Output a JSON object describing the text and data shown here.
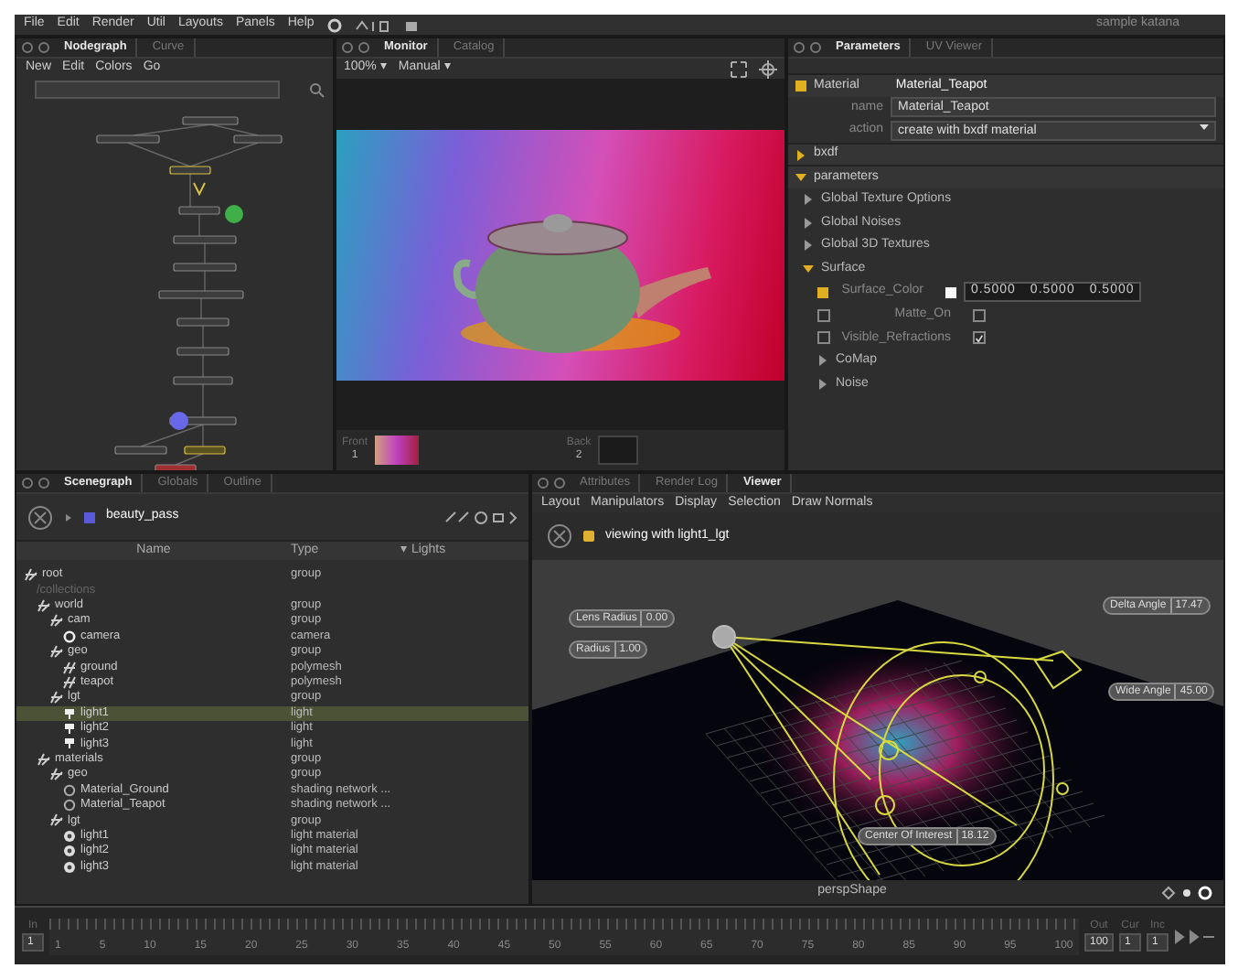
{
  "menu": [
    "File",
    "Edit",
    "Render",
    "Util",
    "Layouts",
    "Panels",
    "Help"
  ],
  "project_title": "sample katana",
  "nodegraph": {
    "tabs": [
      {
        "label": "Nodegraph",
        "selected": true
      },
      {
        "label": "Curve",
        "selected": false
      }
    ],
    "menu": [
      "New",
      "Edit",
      "Colors",
      "Go"
    ]
  },
  "monitor": {
    "tabs": [
      {
        "label": "Monitor",
        "selected": true
      },
      {
        "label": "Catalog",
        "selected": false
      }
    ],
    "toolbar": [
      "100% ▾",
      "Manual ▾"
    ],
    "front_label": "Front",
    "front_index": "1",
    "back_label": "Back",
    "back_index": "2"
  },
  "parameters": {
    "tabs": [
      {
        "label": "Parameters",
        "selected": true
      },
      {
        "label": "UV Viewer",
        "selected": false
      }
    ],
    "rows": [
      {
        "kind": "node",
        "label": "Material",
        "value": "Material_Teapot"
      },
      {
        "kind": "text",
        "label": "name",
        "value": "Material_Teapot"
      },
      {
        "kind": "dropdown",
        "label": "action",
        "value": "create with bxdf material"
      },
      {
        "kind": "section",
        "label": "bxdf",
        "expanded": false
      },
      {
        "kind": "section",
        "label": "parameters",
        "expanded": true
      },
      {
        "kind": "group",
        "label": "Global Texture Options",
        "expanded": false
      },
      {
        "kind": "group",
        "label": "Global Noises",
        "expanded": false
      },
      {
        "kind": "group",
        "label": "Global 3D Textures",
        "expanded": false
      },
      {
        "kind": "group",
        "label": "Surface",
        "expanded": true
      },
      {
        "kind": "color",
        "label": "Surface_Color",
        "values": [
          "0.5000",
          "0.5000",
          "0.5000"
        ]
      },
      {
        "kind": "check",
        "label": "Matte_On",
        "checked": false
      },
      {
        "kind": "check",
        "label": "Visible_Refractions",
        "checked": true
      },
      {
        "kind": "subgroup",
        "label": "CoMap",
        "expanded": false
      },
      {
        "kind": "subgroup",
        "label": "Noise",
        "expanded": false
      }
    ]
  },
  "scenegraph": {
    "tabs": [
      {
        "label": "Scenegraph",
        "selected": true
      },
      {
        "label": "Globals",
        "selected": false
      },
      {
        "label": "Outline",
        "selected": false
      }
    ],
    "pass": "beauty_pass",
    "columns": [
      "Name",
      "Type",
      "▾ Lights"
    ],
    "tree": [
      {
        "kind": "group",
        "name": "root",
        "type": "group",
        "selected": false,
        "children": [
          {
            "kind": "collection",
            "name": "/collections",
            "selected": false
          },
          {
            "kind": "group",
            "name": "world",
            "type": "group",
            "selected": false,
            "children": [
              {
                "kind": "group",
                "name": "cam",
                "type": "group",
                "selected": false,
                "children": [
                  {
                    "kind": "camera",
                    "name": "camera",
                    "type": "camera",
                    "selected": false
                  }
                ]
              },
              {
                "kind": "group",
                "name": "geo",
                "type": "group",
                "selected": false,
                "children": [
                  {
                    "kind": "mesh",
                    "name": "ground",
                    "type": "polymesh",
                    "selected": false
                  },
                  {
                    "kind": "mesh",
                    "name": "teapot",
                    "type": "polymesh",
                    "selected": false
                  }
                ]
              },
              {
                "kind": "group",
                "name": "lgt",
                "type": "group",
                "selected": false,
                "children": [
                  {
                    "kind": "light",
                    "name": "light1",
                    "type": "light",
                    "selected": true
                  },
                  {
                    "kind": "light",
                    "name": "light2",
                    "type": "light",
                    "selected": false
                  },
                  {
                    "kind": "light",
                    "name": "light3",
                    "type": "light",
                    "selected": false
                  }
                ]
              }
            ]
          },
          {
            "kind": "group",
            "name": "materials",
            "type": "group",
            "selected": false,
            "children": [
              {
                "kind": "group",
                "name": "geo",
                "type": "group",
                "selected": false,
                "children": [
                  {
                    "kind": "material",
                    "name": "Material_Ground",
                    "type": "shading network ...",
                    "selected": false
                  },
                  {
                    "kind": "material",
                    "name": "Material_Teapot",
                    "type": "shading network ...",
                    "selected": false
                  }
                ]
              },
              {
                "kind": "group",
                "name": "lgt",
                "type": "group",
                "selected": false,
                "children": [
                  {
                    "kind": "lightmat",
                    "name": "light1",
                    "type": "light material",
                    "selected": false
                  },
                  {
                    "kind": "lightmat",
                    "name": "light2",
                    "type": "light material",
                    "selected": false
                  },
                  {
                    "kind": "lightmat",
                    "name": "light3",
                    "type": "light material",
                    "selected": false
                  }
                ]
              }
            ]
          }
        ]
      }
    ]
  },
  "viewer": {
    "tabs": [
      {
        "label": "Attributes",
        "selected": false
      },
      {
        "label": "Render Log",
        "selected": false
      },
      {
        "label": "Viewer",
        "selected": true
      }
    ],
    "menu": [
      "Layout",
      "Manipulators",
      "Display",
      "Selection",
      "Draw Normals"
    ],
    "status": "viewing with light1_lgt",
    "handles": [
      {
        "label": "Lens Radius",
        "value": "0.00"
      },
      {
        "label": "Radius",
        "value": "1.00"
      },
      {
        "label": "Delta Angle",
        "value": "17.47"
      },
      {
        "label": "Wide Angle",
        "value": "45.00"
      },
      {
        "label": "Center Of Interest",
        "value": "18.12"
      }
    ],
    "camera": "perspShape"
  },
  "timeline": {
    "in_label": "In",
    "in_value": "1",
    "ticks": [
      "1",
      "5",
      "10",
      "15",
      "20",
      "25",
      "30",
      "35",
      "40",
      "45",
      "50",
      "55",
      "60",
      "65",
      "70",
      "75",
      "80",
      "85",
      "90",
      "95",
      "100"
    ],
    "fields": [
      {
        "label": "Out",
        "value": "100"
      },
      {
        "label": "Cur",
        "value": "1"
      },
      {
        "label": "Inc",
        "value": "1"
      }
    ]
  }
}
